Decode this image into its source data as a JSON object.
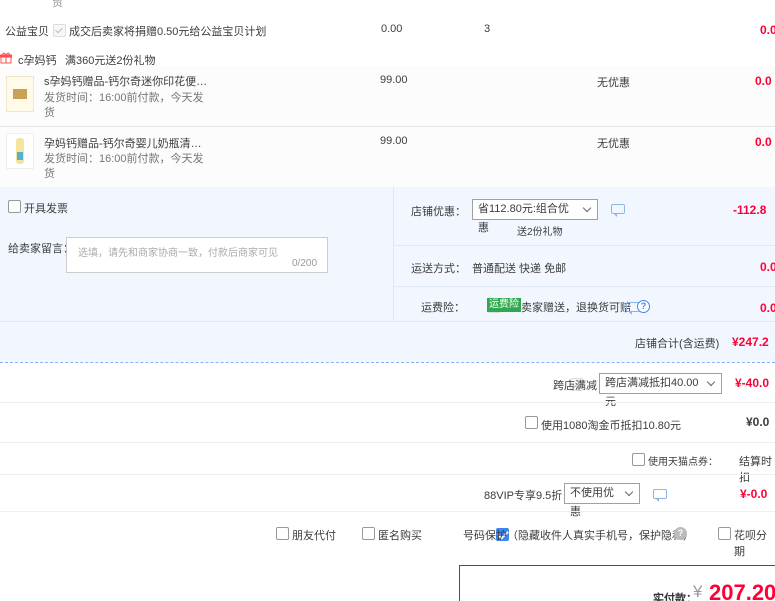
{
  "top_fragment": "贸",
  "charity": {
    "label": "公益宝贝",
    "text": "成交后卖家将捐赠0.50元给公益宝贝计划",
    "price": "0.00",
    "qty": "3",
    "subtotal": "0.0"
  },
  "promo": {
    "shop": "c孕妈钙",
    "text": "满360元送2份礼物"
  },
  "items": [
    {
      "title": "s孕妈钙赠品-钙尔奇迷你印花便…",
      "ship_line1": "发货时间：16:00前付款，今天发",
      "ship_line2": "货",
      "price": "99.00",
      "discount": "无优惠",
      "subtotal": "0.0"
    },
    {
      "title": "孕妈钙赠品-钙尔奇婴儿奶瓶清…",
      "ship_line1": "发货时间：16:00前付款，今天发",
      "ship_line2": "货",
      "price": "99.00",
      "discount": "无优惠",
      "subtotal": "0.0"
    }
  ],
  "invoice_label": "开具发票",
  "message": {
    "label": "给卖家留言：",
    "placeholder": "选填，请先和商家协商一致，付款后商家可见",
    "counter": "0/200"
  },
  "shop_discount": {
    "label": "店铺优惠：",
    "selected": "省112.80元:组合优惠",
    "note": "送2份礼物",
    "amount": "-112.8"
  },
  "shipping": {
    "label": "运送方式：",
    "value": "普通配送 快递 免邮",
    "amount": "0.0"
  },
  "insurance": {
    "label": "运费险：",
    "badge": "运费险",
    "text": "卖家赠送，退换货可赔",
    "amount": "0.0"
  },
  "shop_total": {
    "label": "店铺合计(含运费)",
    "amount": "¥247.2"
  },
  "cross_store": {
    "label": "跨店满减",
    "selected": "跨店满减抵扣40.00元",
    "amount": "¥-40.0"
  },
  "coins": {
    "label": "使用1080淘金币抵扣10.80元",
    "amount": "¥0.0"
  },
  "tmall_points": {
    "label": "使用天猫点券：",
    "extra": "结算时扣"
  },
  "vip": {
    "label": "88VIP专享9.5折",
    "selected": "不使用优惠",
    "amount": "¥-0.0"
  },
  "options": {
    "friend_pay": "朋友代付",
    "anonymous": "匿名购买",
    "privacy": "号码保护（隐藏收件人真实手机号，保护隐私）",
    "installment": "花呗分期"
  },
  "payment": {
    "label": "实付款：",
    "currency": "¥",
    "amount": "207.20"
  },
  "colors": {
    "accent_red": "#ff0036",
    "accent_blue": "#3a86f7",
    "panel_bg": "#f2f7ff",
    "badge_green": "#2fa84f"
  }
}
